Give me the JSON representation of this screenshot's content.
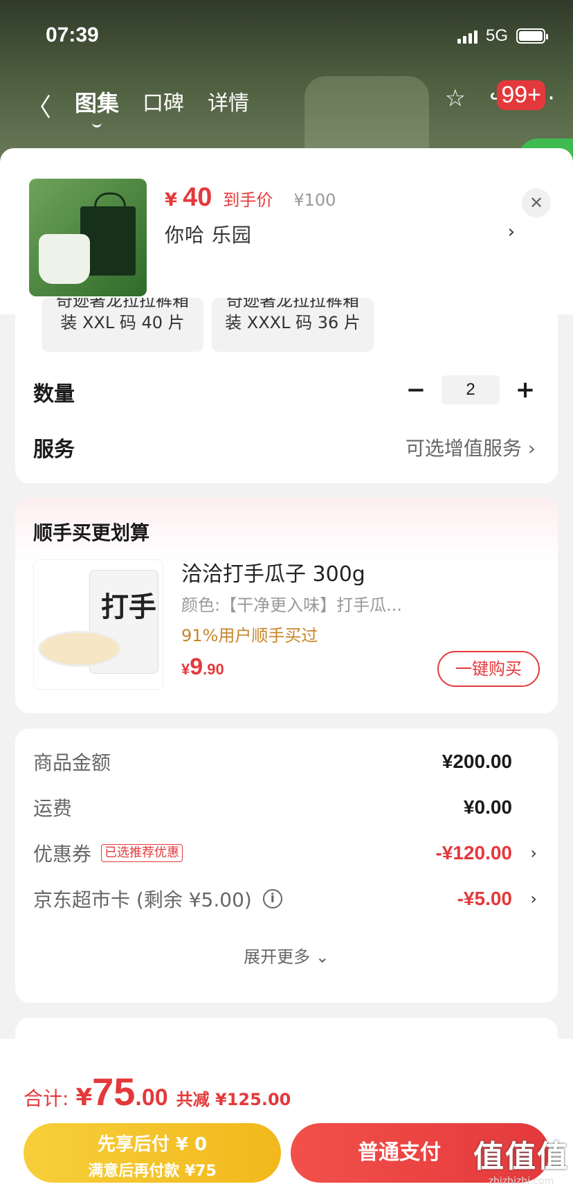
{
  "status": {
    "time": "07:39",
    "network": "5G"
  },
  "nav": {
    "tabs": [
      "图集",
      "口碑",
      "详情"
    ],
    "badge": "99+"
  },
  "product": {
    "price_symbol": "¥",
    "price": "40",
    "price_tag": "到手价",
    "original_price": "¥100",
    "name": "你哈  乐园"
  },
  "specs": [
    {
      "line1": "奇迹著龙拉拉裤箱",
      "line2": "装 XXL 码 40 片"
    },
    {
      "line1": "奇迹著龙拉拉裤箱",
      "line2": "装 XXXL 码 36 片"
    }
  ],
  "quantity": {
    "label": "数量",
    "value": "2",
    "minus": "−",
    "plus": "+"
  },
  "service": {
    "label": "服务",
    "value": "可选增值服务"
  },
  "addon": {
    "title": "顺手买更划算",
    "name": "洽洽打手瓜子 300g",
    "attr": "颜色:【干净更入味】打手瓜...",
    "hint": "91%用户顺手买过",
    "price_symbol": "¥",
    "price_int": "9",
    "price_dec": ".90",
    "button": "一键购买",
    "image_text": "打手"
  },
  "summary": {
    "goods_label": "商品金额",
    "goods_value": "¥200.00",
    "shipping_label": "运费",
    "shipping_value": "¥0.00",
    "coupon_label": "优惠券",
    "coupon_tag": "已选推荐优惠",
    "coupon_value": "-¥120.00",
    "card_label": "京东超市卡 (剩余 ¥5.00)",
    "card_value": "-¥5.00",
    "expand": "展开更多"
  },
  "footer": {
    "total_label": "合计:",
    "total_symbol": "¥",
    "total_int": "75",
    "total_dec": ".00",
    "save": "共减 ¥125.00",
    "later_line1": "先享后付 ¥ 0",
    "later_line2": "满意后再付款 ¥75",
    "pay": "普通支付",
    "watermark": "值值值",
    "watermark_sub": "zhizhizhi.com"
  },
  "colors": {
    "accent": "#e4393c",
    "gold": "#f2b81c",
    "hint": "#c8862a"
  }
}
